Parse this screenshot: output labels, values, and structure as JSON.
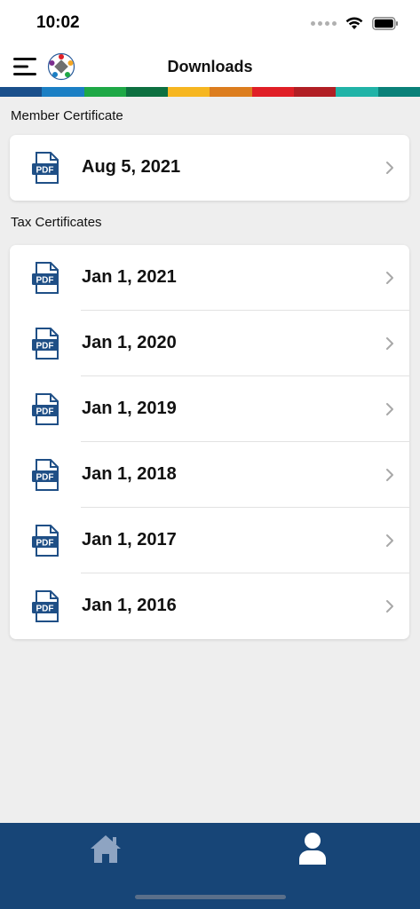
{
  "status_bar": {
    "time": "10:02"
  },
  "header": {
    "title": "Downloads",
    "stripe_colors": [
      "#1a4f8b",
      "#1b7fc4",
      "#1ea846",
      "#0d7040",
      "#f6b620",
      "#dc7d1e",
      "#e01f26",
      "#b11f24",
      "#20b3a7",
      "#0a8179"
    ]
  },
  "sections": {
    "member": {
      "label": "Member Certificate",
      "items": [
        {
          "label": "Aug 5, 2021",
          "icon": "pdf-icon"
        }
      ]
    },
    "tax": {
      "label": "Tax Certificates",
      "items": [
        {
          "label": "Jan 1, 2021",
          "icon": "pdf-icon"
        },
        {
          "label": "Jan 1, 2020",
          "icon": "pdf-icon"
        },
        {
          "label": "Jan 1, 2019",
          "icon": "pdf-icon"
        },
        {
          "label": "Jan 1, 2018",
          "icon": "pdf-icon"
        },
        {
          "label": "Jan 1, 2017",
          "icon": "pdf-icon"
        },
        {
          "label": "Jan 1, 2016",
          "icon": "pdf-icon"
        }
      ]
    }
  },
  "bottom_nav": {
    "items": [
      {
        "icon": "home-icon"
      },
      {
        "icon": "user-icon"
      }
    ],
    "background": "#174577"
  },
  "colors": {
    "pdf_blue": "#1f4f86",
    "page_bg": "#eeeeee"
  }
}
